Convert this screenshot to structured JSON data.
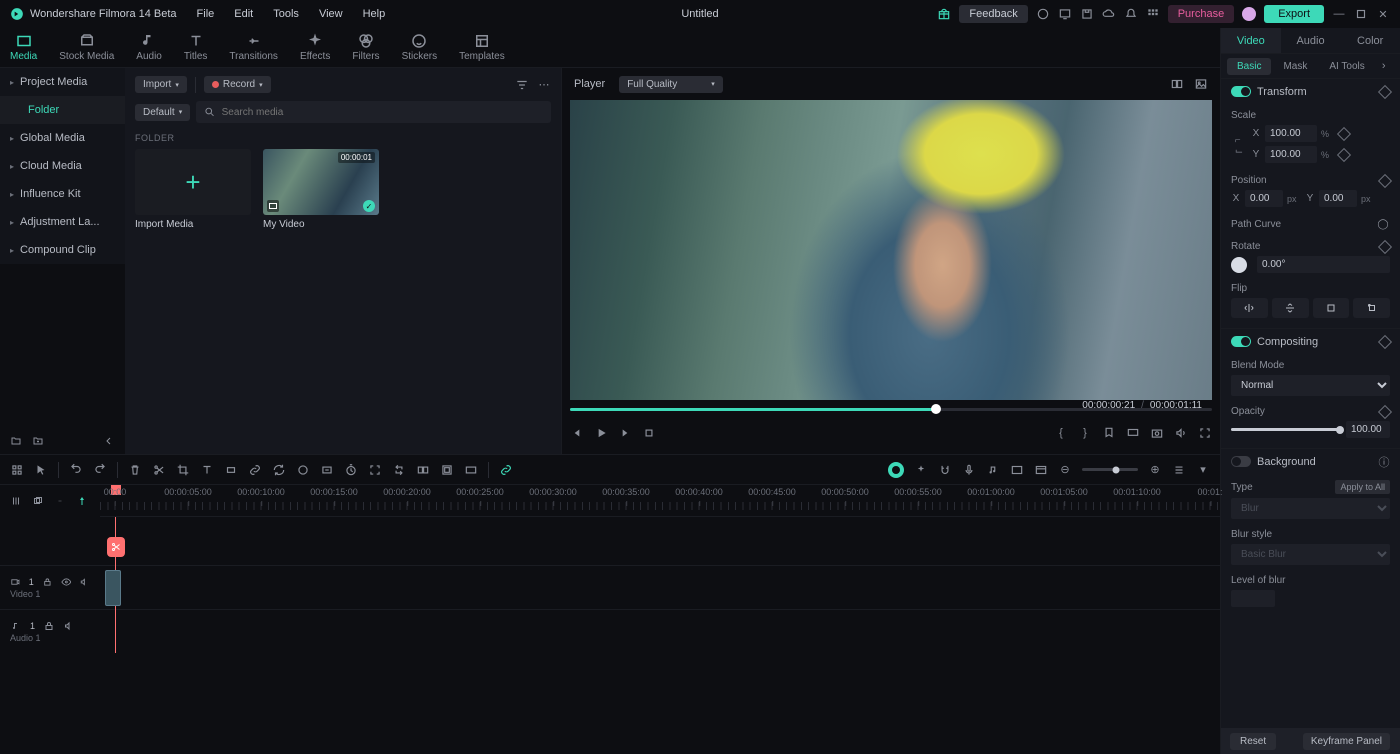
{
  "app_title": "Wondershare Filmora 14 Beta",
  "menu": [
    "File",
    "Edit",
    "Tools",
    "View",
    "Help"
  ],
  "doc_title": "Untitled",
  "feedback": "Feedback",
  "purchase": "Purchase",
  "export": "Export",
  "mode_tabs": [
    "Media",
    "Stock Media",
    "Audio",
    "Titles",
    "Transitions",
    "Effects",
    "Filters",
    "Stickers",
    "Templates"
  ],
  "sidebar": {
    "items": [
      "Project Media",
      "Global Media",
      "Cloud Media",
      "Influence Kit",
      "Adjustment La...",
      "Compound Clip"
    ],
    "sub": "Folder"
  },
  "media": {
    "import": "Import",
    "record": "Record",
    "default": "Default",
    "search_ph": "Search media",
    "folder_label": "FOLDER",
    "import_media": "Import Media",
    "clip_name": "My Video",
    "clip_dur": "00:00:01"
  },
  "player": {
    "label": "Player",
    "quality": "Full Quality",
    "time_cur": "00:00:00:21",
    "time_tot": "00:00:01:11"
  },
  "right": {
    "tabs": [
      "Video",
      "Audio",
      "Color"
    ],
    "sub": [
      "Basic",
      "Mask",
      "AI Tools"
    ],
    "transform": "Transform",
    "scale": "Scale",
    "X": "X",
    "Y": "Y",
    "sx": "100.00",
    "sy": "100.00",
    "pct": "%",
    "position": "Position",
    "px": "0.00",
    "py": "0.00",
    "pxu": "px",
    "pathcurve": "Path Curve",
    "rotate": "Rotate",
    "rv": "0.00°",
    "flip": "Flip",
    "compositing": "Compositing",
    "blend": "Blend Mode",
    "blend_v": "Normal",
    "opacity": "Opacity",
    "op_v": "100.00",
    "background": "Background",
    "type": "Type",
    "applyall": "Apply to All",
    "blur": "Blur",
    "blurstyle": "Blur style",
    "basicblur": "Basic Blur",
    "levelblur": "Level of blur",
    "reset": "Reset",
    "kfpanel": "Keyframe Panel"
  },
  "timeline": {
    "ticks": [
      "00:00",
      "00:00:05:00",
      "00:00:10:00",
      "00:00:15:00",
      "00:00:20:00",
      "00:00:25:00",
      "00:00:30:00",
      "00:00:35:00",
      "00:00:40:00",
      "00:00:45:00",
      "00:00:50:00",
      "00:00:55:00",
      "00:01:00:00",
      "00:01:05:00",
      "00:01:10:00",
      "00:01:"
    ],
    "video_track": "Video 1",
    "audio_track": "Audio 1"
  }
}
